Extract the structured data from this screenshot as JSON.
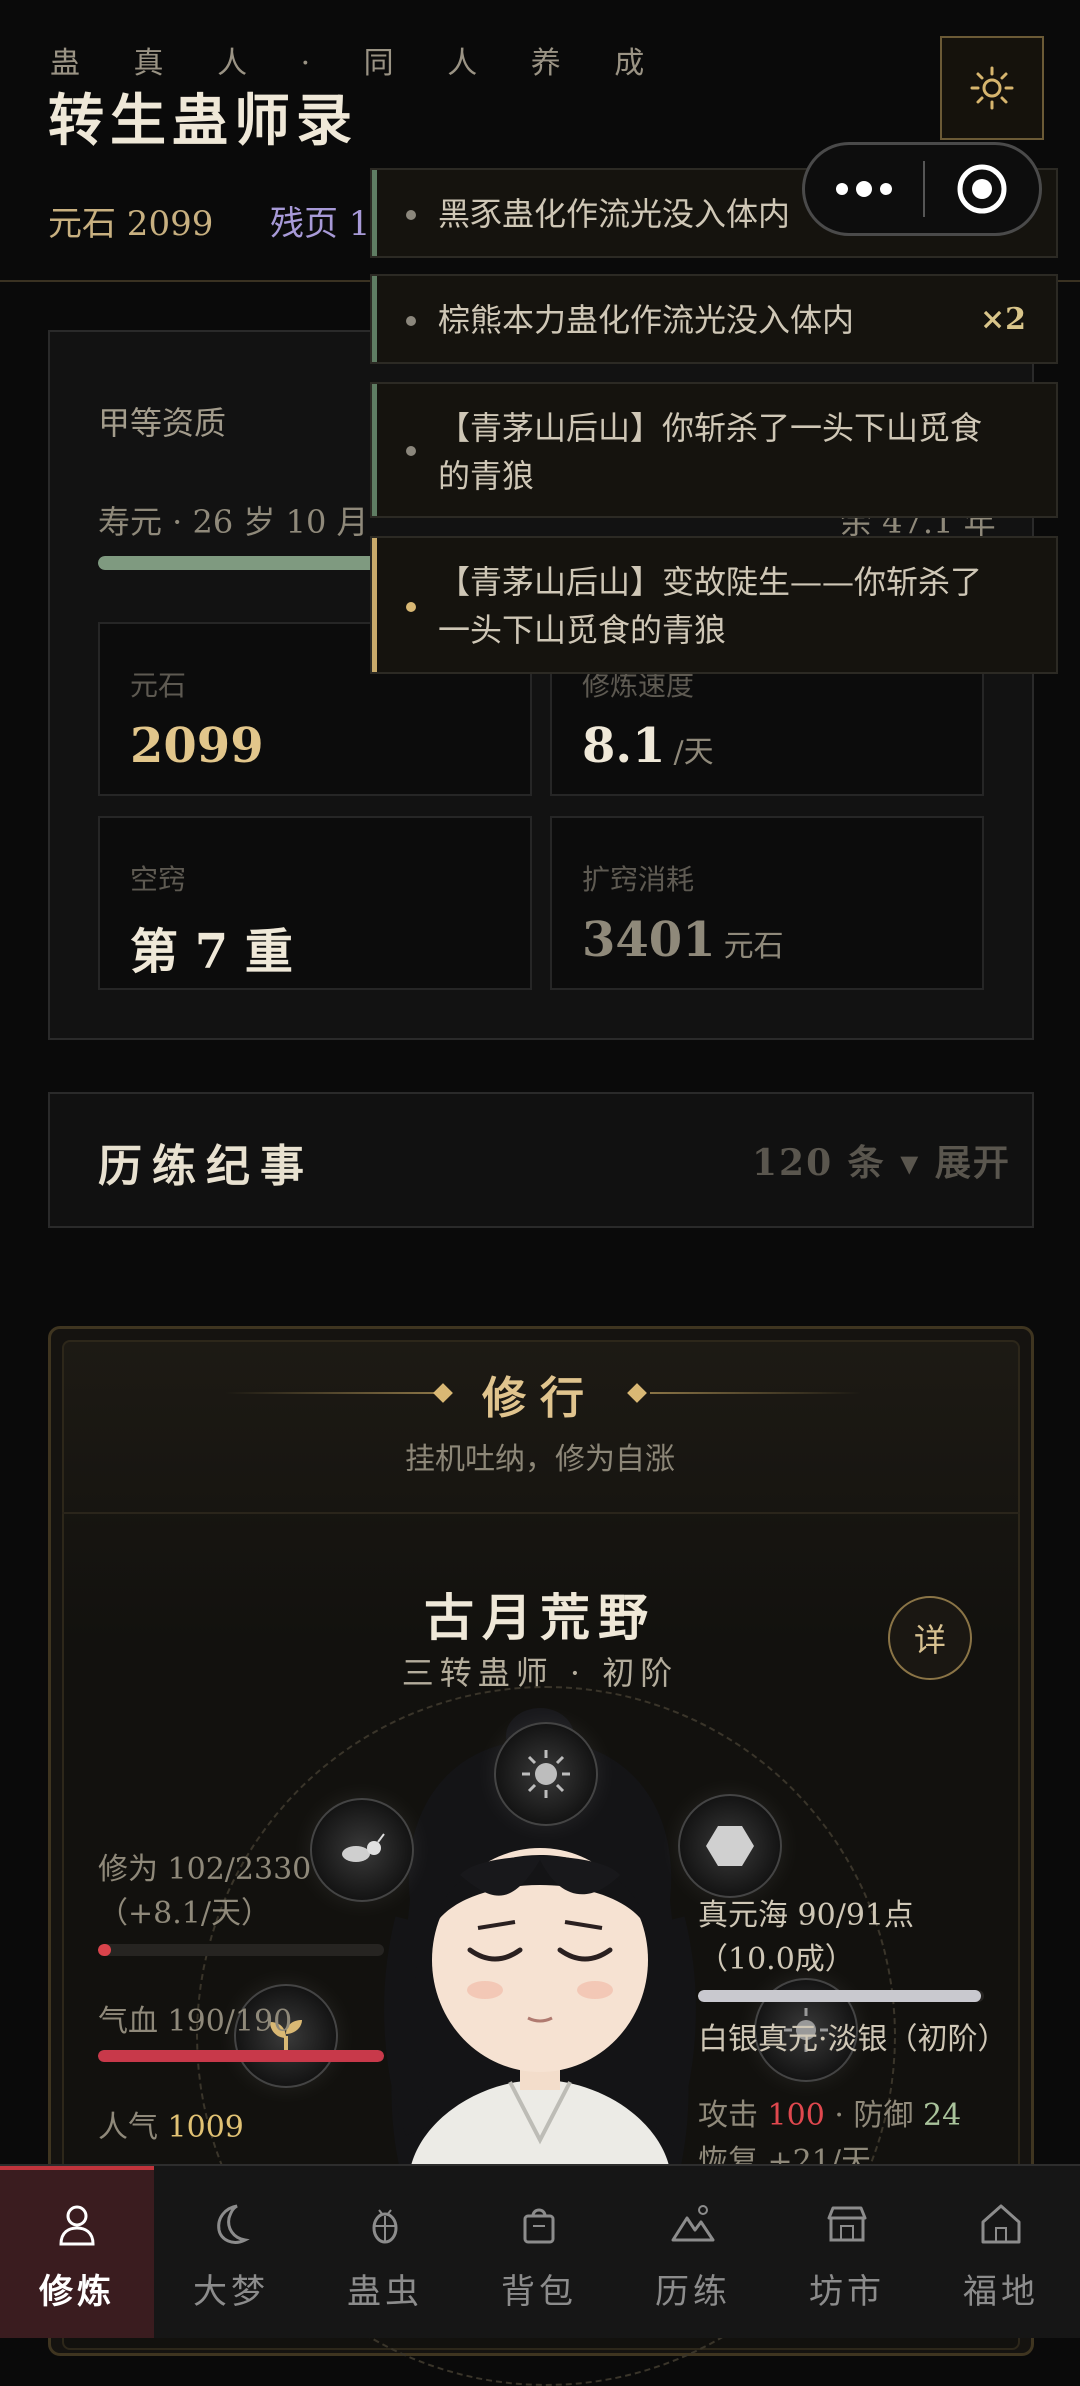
{
  "header": {
    "subtitle": "蛊 真 人 · 同 人 养 成",
    "title": "转生蛊师录",
    "settings_icon": "gear-icon"
  },
  "resources": {
    "yuanshi": "元石 2099",
    "canye": "残页 1"
  },
  "status": {
    "aptitude": "甲等资质",
    "lifespan": "寿元 · 26 岁 10 月",
    "lifespan_remaining": "余 47.1 年",
    "lifespan_fraction": 0.36,
    "stats": [
      {
        "label": "元石",
        "value": "2099",
        "unit": "",
        "color": "#e2c68b"
      },
      {
        "label": "修炼速度",
        "value": "8.1",
        "unit": "/天",
        "color": "#efe8d8"
      },
      {
        "label": "空窍",
        "value": "第 7 重",
        "unit": "",
        "color": "#efe8d8"
      },
      {
        "label": "扩窍消耗",
        "value": "3401",
        "unit": "元石",
        "color": "#8f897a"
      }
    ]
  },
  "notifications": [
    {
      "text": "黑豕蛊化作流光没入体内",
      "count": "",
      "accent": "#5f7d63"
    },
    {
      "text": "棕熊本力蛊化作流光没入体内",
      "count": "×2",
      "accent": "#5f7d63"
    },
    {
      "text": "【青茅山后山】你斩杀了一头下山觅食的青狼",
      "count": "",
      "accent": "#5f7d63"
    },
    {
      "text": "【青茅山后山】变故陡生——你斩杀了一头下山觅食的青狼",
      "count": "",
      "accent": "#c9aa6a"
    }
  ],
  "chronicle": {
    "title": "历练纪事",
    "meta": "120 条 ▾ 展开"
  },
  "cultivation": {
    "title": "修行",
    "subtitle": "挂机吐纳，修为自涨",
    "name": "古月荒野",
    "rank": "三转蛊师 · 初阶",
    "detail_button": "详",
    "xiuwei": "修为 102/2330",
    "xiuwei_rate": "（+8.1/天）",
    "xiuwei_fraction": 0.044,
    "qixue": "气血 190/190",
    "qixue_fraction": 1.0,
    "renqi_label": "人气",
    "renqi_value": "1009",
    "zhenyuan": "真元海 90/91点",
    "zhenyuan_sub": "（10.0成）",
    "zhenyuan_fraction": 0.99,
    "zhenyuan_type": "白银真元·淡银（初阶）",
    "attack_label": "攻击",
    "attack_value": "100",
    "defense_label": "· 防御",
    "defense_value": "24",
    "recovery": "恢复 +21/天"
  },
  "nav": [
    {
      "label": "修炼",
      "icon": "person-icon",
      "active": true
    },
    {
      "label": "大梦",
      "icon": "moon-icon",
      "active": false
    },
    {
      "label": "蛊虫",
      "icon": "bug-icon",
      "active": false
    },
    {
      "label": "背包",
      "icon": "bag-icon",
      "active": false
    },
    {
      "label": "历练",
      "icon": "mountain-icon",
      "active": false
    },
    {
      "label": "坊市",
      "icon": "shop-icon",
      "active": false
    },
    {
      "label": "福地",
      "icon": "home-icon",
      "active": false
    }
  ]
}
